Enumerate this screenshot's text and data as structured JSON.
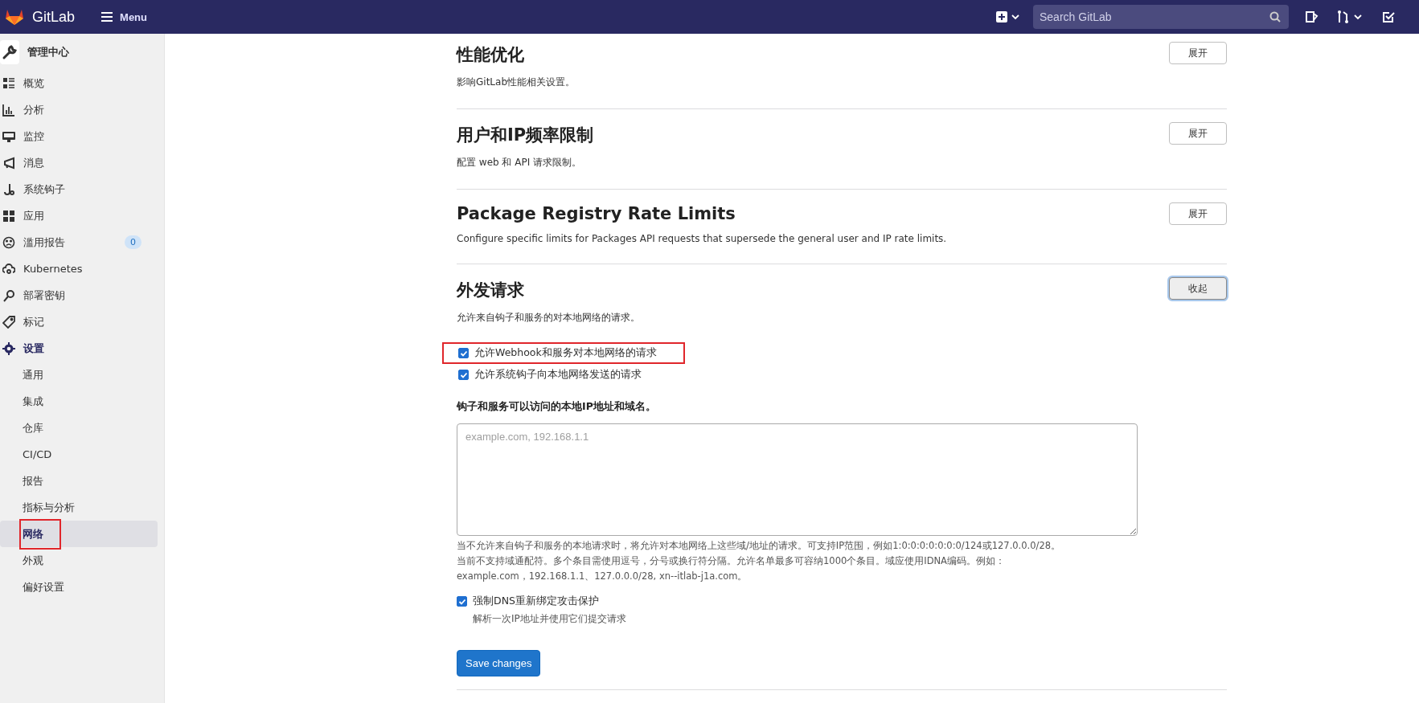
{
  "topbar": {
    "brand": "GitLab",
    "menu": "Menu",
    "search": {
      "placeholder": "Search GitLab"
    }
  },
  "sidebar": {
    "title": "管理中心",
    "items": [
      {
        "label": "概览",
        "selected": false
      },
      {
        "label": "分析",
        "selected": false
      },
      {
        "label": "监控",
        "selected": false
      },
      {
        "label": "消息",
        "selected": false
      },
      {
        "label": "系统钩子",
        "selected": false
      },
      {
        "label": "应用",
        "selected": false
      },
      {
        "label": "滥用报告",
        "selected": false,
        "badge": "0"
      },
      {
        "label": "Kubernetes",
        "selected": false
      },
      {
        "label": "部署密钥",
        "selected": false
      },
      {
        "label": "标记",
        "selected": false
      },
      {
        "label": "设置",
        "selected": false,
        "expanded": true,
        "children": [
          {
            "label": "通用",
            "selected": false,
            "annotated": false
          },
          {
            "label": "集成",
            "selected": false,
            "annotated": false
          },
          {
            "label": "仓库",
            "selected": false,
            "annotated": false
          },
          {
            "label": "CI/CD",
            "selected": false,
            "annotated": false
          },
          {
            "label": "报告",
            "selected": false,
            "annotated": false
          },
          {
            "label": "指标与分析",
            "selected": false,
            "annotated": false
          },
          {
            "label": "网络",
            "selected": true,
            "annotated": true
          },
          {
            "label": "外观",
            "selected": false,
            "annotated": false
          },
          {
            "label": "偏好设置",
            "selected": false,
            "annotated": false
          }
        ]
      }
    ]
  },
  "sections": [
    {
      "title": "性能优化",
      "description": "影响GitLab性能相关设置。",
      "button": "展开",
      "expanded": false
    },
    {
      "title": "用户和IP频率限制",
      "description": "配置 web 和 API 请求限制。",
      "button": "展开",
      "expanded": false
    },
    {
      "title": "Package Registry Rate Limits",
      "description": "Configure specific limits for Packages API requests that supersede the general user and IP rate limits.",
      "button": "展开",
      "expanded": false
    },
    {
      "title": "外发请求",
      "description": "允许来自钩子和服务的对本地网络的请求。",
      "button": "收起",
      "expanded": true
    }
  ],
  "outbound": {
    "checkboxes": [
      {
        "label": "允许Webhook和服务对本地网络的请求",
        "checked": true,
        "annotated": true
      },
      {
        "label": "允许系统钩子向本地网络发送的请求",
        "checked": true,
        "annotated": false
      }
    ],
    "allowlist": {
      "label": "钩子和服务可以访问的本地IP地址和域名。",
      "placeholder": "example.com, 192.168.1.1",
      "help": [
        "当不允许来自钩子和服务的本地请求时，将允许对本地网络上这些域/地址的请求。可支持IP范围，例如1:0:0:0:0:0:0:0/124或127.0.0.0/28。",
        "当前不支持域通配符。多个条目需使用逗号，分号或换行符分隔。允许名单最多可容纳1000个条目。域应使用IDNA编码。例如：",
        "example.com，192.168.1.1、127.0.0.0/28, xn--itlab-j1a.com。"
      ]
    },
    "dns": {
      "label": "强制DNS重新绑定攻击保护",
      "help": "解析一次IP地址并使用它们提交请求",
      "checked": true
    },
    "save": "Save changes"
  }
}
